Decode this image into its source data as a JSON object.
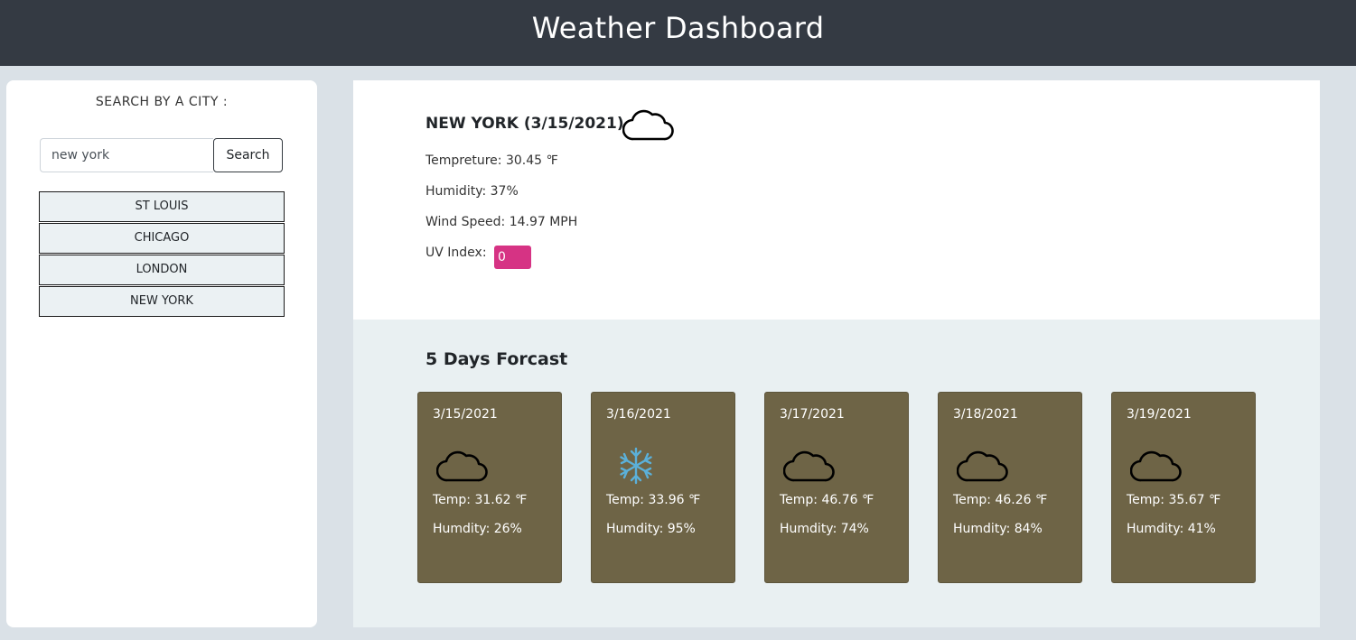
{
  "header": {
    "title": "Weather Dashboard"
  },
  "sidebar": {
    "search_title": "SEARCH BY A CITY :",
    "search_value": "new york",
    "search_button": "Search",
    "history": [
      "ST LOUIS",
      "CHICAGO",
      "LONDON",
      "NEW YORK"
    ]
  },
  "current": {
    "city_date": "NEW YORK (3/15/2021)",
    "icon": "cloud-icon",
    "temp": "Tempreture: 30.45 ℉",
    "humidity": "Humidity: 37%",
    "wind": "Wind Speed: 14.97 MPH",
    "uv_label": "UV Index:",
    "uv_value": "0",
    "uv_color": "#d63384"
  },
  "forecast": {
    "title": "5 Days Forcast",
    "card_color": "#6e6446",
    "days": [
      {
        "date": "3/15/2021",
        "icon": "cloud-icon",
        "temp": "Temp: 31.62 ℉",
        "humidity": "Humdity: 26%"
      },
      {
        "date": "3/16/2021",
        "icon": "snowflake-icon",
        "temp": "Temp: 33.96 ℉",
        "humidity": "Humdity: 95%"
      },
      {
        "date": "3/17/2021",
        "icon": "cloud-icon",
        "temp": "Temp: 46.76 ℉",
        "humidity": "Humdity: 74%"
      },
      {
        "date": "3/18/2021",
        "icon": "cloud-icon",
        "temp": "Temp: 46.26 ℉",
        "humidity": "Humdity: 84%"
      },
      {
        "date": "3/19/2021",
        "icon": "cloud-icon",
        "temp": "Temp: 35.67 ℉",
        "humidity": "Humdity: 41%"
      }
    ]
  }
}
